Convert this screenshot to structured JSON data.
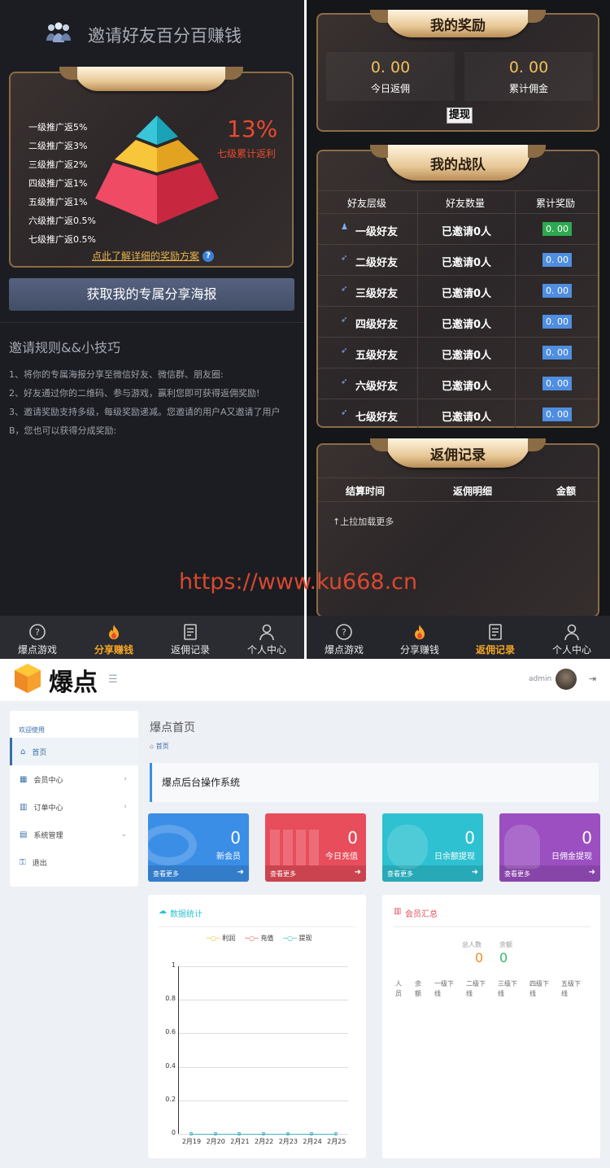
{
  "left": {
    "header_title": "邀请好友百分百赚钱",
    "levels": [
      "一级推广返5%",
      "二级推广返3%",
      "三级推广返2%",
      "四级推广返1%",
      "五级推广返1%",
      "六级推广返0.5%",
      "七级推广返0.5%"
    ],
    "big_percent": "13%",
    "big_percent_label": "七级累计返利",
    "detail_link": "点此了解详细的奖励方案",
    "share_button": "获取我的专属分享海报",
    "rules_title": "邀请规则&&小技巧",
    "rules": [
      "1、将你的专属海报分享至微信好友、微信群、朋友圈:",
      "2、好友通过你的二维码、参与游戏，赢利您即可获得返佣奖励!",
      "3、邀请奖励支持多级，每级奖励递减。您邀请的用户A又邀请了用户B，您也可以获得分成奖励:"
    ],
    "tabs": [
      "爆点游戏",
      "分享赚钱",
      "返佣记录",
      "个人中心"
    ]
  },
  "right": {
    "reward_title": "我的奖励",
    "today_value": "0. 00",
    "today_label": "今日返佣",
    "total_value": "0. 00",
    "total_label": "累计佣金",
    "withdraw_button": "提现",
    "team_title": "我的战队",
    "team_headers": [
      "好友层级",
      "好友数量",
      "累计奖励"
    ],
    "team_rows": [
      {
        "level": "一级好友",
        "count": "已邀请0人",
        "reward": "0. 00"
      },
      {
        "level": "二级好友",
        "count": "已邀请0人",
        "reward": "0. 00"
      },
      {
        "level": "三级好友",
        "count": "已邀请0人",
        "reward": "0. 00"
      },
      {
        "level": "四级好友",
        "count": "已邀请0人",
        "reward": "0. 00"
      },
      {
        "level": "五级好友",
        "count": "已邀请0人",
        "reward": "0. 00"
      },
      {
        "level": "六级好友",
        "count": "已邀请0人",
        "reward": "0. 00"
      },
      {
        "level": "七级好友",
        "count": "已邀请0人",
        "reward": "0. 00"
      }
    ],
    "records_title": "返佣记录",
    "records_headers": [
      "结算时间",
      "返佣明细",
      "金额"
    ],
    "load_more": "↑上拉加载更多",
    "tabs": [
      "爆点游戏",
      "分享赚钱",
      "返佣记录",
      "个人中心"
    ]
  },
  "watermark": "https://www.ku668.cn",
  "admin": {
    "logo_text": "爆点",
    "username": "admin",
    "sidebar_welcome": "欢迎使用",
    "sidebar_items": [
      "首页",
      "会员中心",
      "订单中心",
      "系统管理",
      "退出"
    ],
    "page_title": "爆点首页",
    "breadcrumb": "首页",
    "banner": "爆点后台操作系统",
    "stats": [
      {
        "value": "0",
        "label": "新会员",
        "more": "查看更多",
        "color": "#3a8ee6"
      },
      {
        "value": "0",
        "label": "今日充值",
        "more": "查看更多",
        "color": "#e84d5b"
      },
      {
        "value": "0",
        "label": "日余额提现",
        "more": "查看更多",
        "color": "#2ec1d1"
      },
      {
        "value": "0",
        "label": "日佣金提现",
        "more": "查看更多",
        "color": "#9b4fc1"
      }
    ],
    "stats_title": "数据统计",
    "member_title": "会员汇总",
    "member_total_label": "总人数",
    "member_total_value": "0",
    "member_balance_label": "余额",
    "member_balance_value": "0",
    "member_columns": [
      "人员",
      "余额",
      "一级下线",
      "二级下线",
      "三级下线",
      "四级下线",
      "五级下线"
    ]
  },
  "chart_data": {
    "type": "line",
    "x": [
      "2月19",
      "2月20",
      "2月21",
      "2月22",
      "2月23",
      "2月24",
      "2月25"
    ],
    "series": [
      {
        "name": "利润",
        "values": [
          0,
          0,
          0,
          0,
          0,
          0,
          0
        ],
        "color": "#e5c33a"
      },
      {
        "name": "充值",
        "values": [
          0,
          0,
          0,
          0,
          0,
          0,
          0
        ],
        "color": "#e06060"
      },
      {
        "name": "提现",
        "values": [
          0,
          0,
          0,
          0,
          0,
          0,
          0
        ],
        "color": "#3bb8c4"
      }
    ],
    "yticks": [
      "0",
      "0.2",
      "0.4",
      "0.6",
      "0.8",
      "1"
    ],
    "ylim": [
      0,
      1
    ],
    "legend": "top",
    "grid": true
  }
}
